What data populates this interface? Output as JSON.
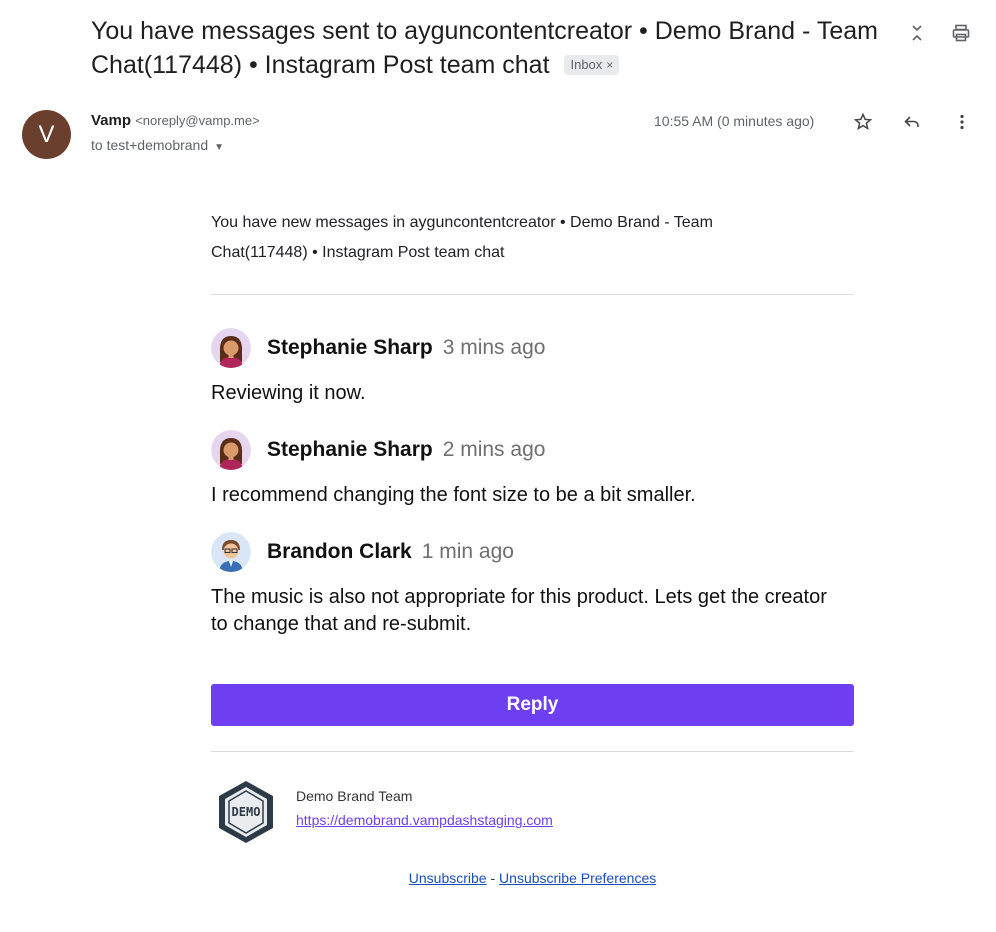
{
  "email": {
    "subject": "You have messages sent to ayguncontentcreator • Demo Brand - Team Chat(117448) • Instagram Post team chat",
    "label_chip": "Inbox",
    "label_remove": "×",
    "sender_initial": "V",
    "sender_name": "Vamp",
    "sender_email": "<noreply@vamp.me>",
    "to_line": "to test+demobrand",
    "time": "10:55 AM (0 minutes ago)"
  },
  "body": {
    "intro": "You have new messages in ayguncontentcreator • Demo Brand - Team Chat(117448) • Instagram Post team chat",
    "messages": [
      {
        "name": "Stephanie Sharp",
        "time": "3 mins ago",
        "text": "Reviewing it now."
      },
      {
        "name": "Stephanie Sharp",
        "time": "2 mins ago",
        "text": "I recommend changing the font size to be a bit smaller."
      },
      {
        "name": "Brandon Clark",
        "time": "1 min ago",
        "text": "The music is also not appropriate for this product. Lets get the creator to change that and re-submit."
      }
    ],
    "reply_label": "Reply"
  },
  "footer": {
    "logo_text": "DEMO",
    "brand_name": "Demo Brand Team",
    "brand_url": "https://demobrand.vampdashstaging.com",
    "unsubscribe": "Unsubscribe",
    "separator": "-",
    "unsubscribe_prefs": "Unsubscribe Preferences"
  },
  "colors": {
    "accent": "#6e3ff0",
    "avatar_bg": "#6b3f2e",
    "link_blue": "#1a4fb8"
  },
  "icons": [
    "collapse-icon",
    "print-icon",
    "star-icon",
    "reply-icon",
    "more-vert-icon",
    "chevron-down-icon"
  ]
}
